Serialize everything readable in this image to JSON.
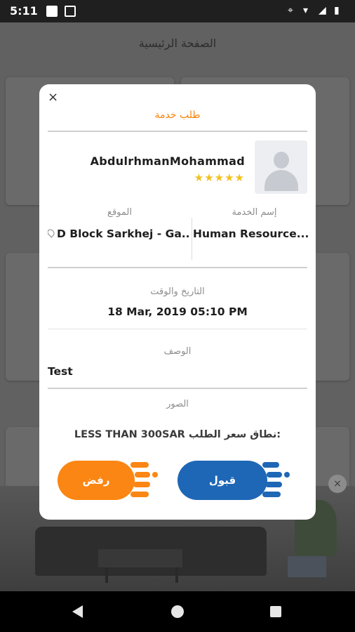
{
  "status_bar": {
    "time": "5:11"
  },
  "background": {
    "title": "الصفحة الرئيسية"
  },
  "modal": {
    "close": "×",
    "title": "طلب خدمة",
    "provider": {
      "name": "AbdulrhmanMohammad",
      "rating": 5,
      "stars": "★★★★★"
    },
    "service": {
      "label": "إسم الخدمة",
      "value": "Human Resource..."
    },
    "location": {
      "label": "الموقع",
      "value": "D Block Sarkhej - Ga..."
    },
    "datetime": {
      "label": "التاريخ والوقت",
      "value": "18 Mar, 2019 05:10 PM"
    },
    "description": {
      "label": "الوصف",
      "value": "Test"
    },
    "images": {
      "label": "الصور"
    },
    "price_range": {
      "label": "نطاق سعر الطلب:",
      "value": "LESS THAN 300SAR"
    },
    "buttons": {
      "reject": "رفض",
      "accept": "قبول"
    },
    "colors": {
      "accent_orange": "#fb8613",
      "accent_blue": "#1e67b6",
      "star": "#f2c01e"
    }
  },
  "ad": {
    "close": "×"
  }
}
